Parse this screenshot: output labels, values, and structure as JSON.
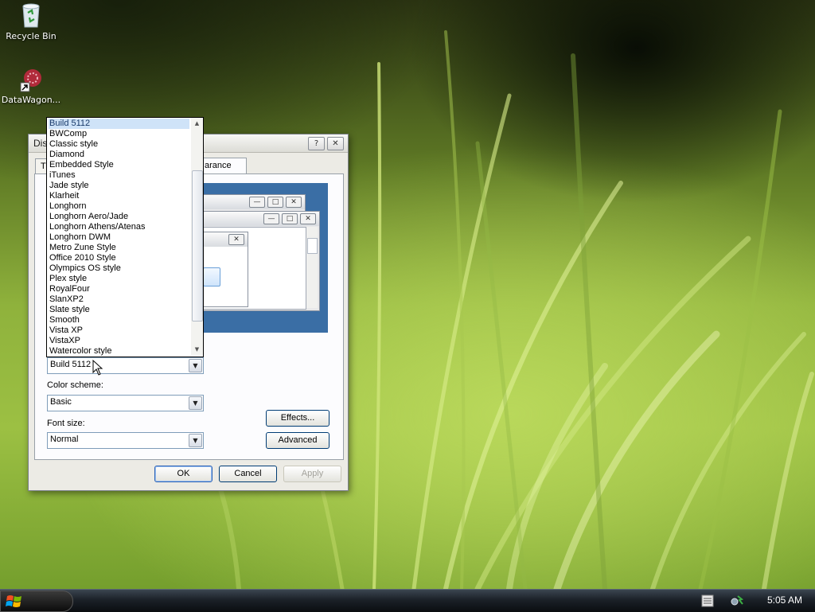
{
  "desktop": {
    "icons": [
      {
        "label": "Recycle Bin"
      },
      {
        "label": "DataWagon..."
      }
    ]
  },
  "dialog": {
    "title": "Dis",
    "help_btn": "?",
    "close_btn": "✕",
    "tabs": [
      {
        "label": "T"
      },
      {
        "label": "arance"
      }
    ],
    "preview": {
      "min": "—",
      "max": "□",
      "close": "✕"
    },
    "windows_style_value": "Build 5112",
    "color_scheme_label": "Color scheme:",
    "color_scheme_value": "Basic",
    "font_size_label": "Font size:",
    "font_size_value": "Normal",
    "effects_button": "Effects...",
    "advanced_button": "Advanced",
    "ok_button": "OK",
    "cancel_button": "Cancel",
    "apply_button": "Apply"
  },
  "dropdown": {
    "items": [
      "Build 5112",
      "BWComp",
      "Classic style",
      "Diamond",
      "Embedded Style",
      "iTunes",
      "Jade style",
      "Klarheit",
      "Longhorn",
      "Longhorn Aero/Jade",
      "Longhorn Athens/Atenas",
      "Longhorn DWM",
      "Metro Zune Style",
      "Office 2010 Style",
      "Olympics OS style",
      "Plex style",
      "RoyalFour",
      "SlanXP2",
      "Slate style",
      "Smooth",
      "Vista XP",
      "VistaXP",
      "Watercolor style"
    ],
    "selected": "Build 5112"
  },
  "taskbar": {
    "clock": "5:05 AM"
  }
}
